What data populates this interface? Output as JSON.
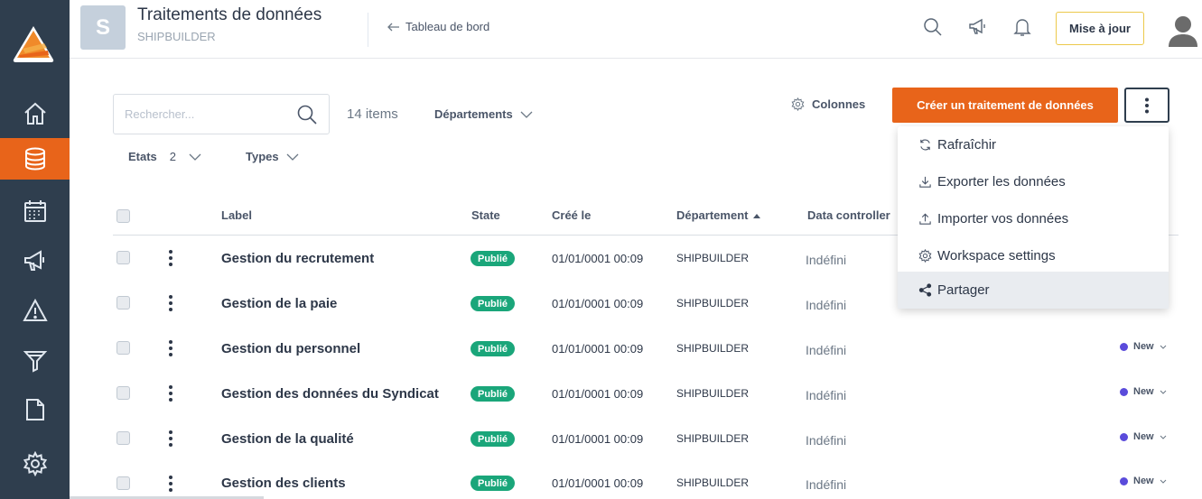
{
  "header": {
    "workspace_initial": "S",
    "title": "Traitements de données",
    "subtitle": "SHIPBUILDER",
    "back_link": "Tableau de bord",
    "update_button": "Mise à jour"
  },
  "sidebar": {
    "items": [
      {
        "icon": "home-icon",
        "active": false
      },
      {
        "icon": "database-icon",
        "active": true
      },
      {
        "icon": "calendar-icon",
        "active": false
      },
      {
        "icon": "megaphone-icon",
        "active": false
      },
      {
        "icon": "warning-icon",
        "active": false
      },
      {
        "icon": "filter-icon",
        "active": false
      },
      {
        "icon": "document-icon",
        "active": false
      },
      {
        "icon": "settings-icon",
        "active": false
      }
    ]
  },
  "toolbar": {
    "search_placeholder": "Rechercher...",
    "items_count": "14 items",
    "departments_filter": "Départements",
    "states_filter": "Etats",
    "states_count": "2",
    "types_filter": "Types",
    "columns_button": "Colonnes",
    "create_button": "Créer un traitement de données"
  },
  "table": {
    "headers": {
      "label": "Label",
      "state": "State",
      "created": "Créé le",
      "department": "Département",
      "data_controller": "Data controller"
    },
    "rows": [
      {
        "label": "Gestion du recrutement",
        "state": "Publié",
        "created": "01/01/0001 00:09",
        "department": "SHIPBUILDER",
        "data_controller": "Indéfini",
        "status": ""
      },
      {
        "label": "Gestion de la paie",
        "state": "Publié",
        "created": "01/01/0001 00:09",
        "department": "SHIPBUILDER",
        "data_controller": "Indéfini",
        "status": ""
      },
      {
        "label": "Gestion du personnel",
        "state": "Publié",
        "created": "01/01/0001 00:09",
        "department": "SHIPBUILDER",
        "data_controller": "Indéfini",
        "status": "New"
      },
      {
        "label": "Gestion des données du Syndicat",
        "state": "Publié",
        "created": "01/01/0001 00:09",
        "department": "SHIPBUILDER",
        "data_controller": "Indéfini",
        "status": "New"
      },
      {
        "label": "Gestion de la qualité",
        "state": "Publié",
        "created": "01/01/0001 00:09",
        "department": "SHIPBUILDER",
        "data_controller": "Indéfini",
        "status": "New"
      },
      {
        "label": "Gestion des clients",
        "state": "Publié",
        "created": "01/01/0001 00:09",
        "department": "SHIPBUILDER",
        "data_controller": "Indéfini",
        "status": "New"
      }
    ]
  },
  "dropdown": {
    "items": [
      {
        "label": "Rafraîchir",
        "icon": "refresh-icon"
      },
      {
        "label": "Exporter les données",
        "icon": "download-icon"
      },
      {
        "label": "Importer vos données",
        "icon": "upload-icon"
      },
      {
        "label": "Workspace settings",
        "icon": "gear-icon"
      },
      {
        "label": "Partager",
        "icon": "share-icon"
      }
    ]
  },
  "colors": {
    "sidebar_bg": "#2f3e4e",
    "accent": "#e8641a",
    "published_pill": "#1aa67a",
    "status_dot": "#5a4bdb",
    "update_border": "#ecc94b"
  }
}
